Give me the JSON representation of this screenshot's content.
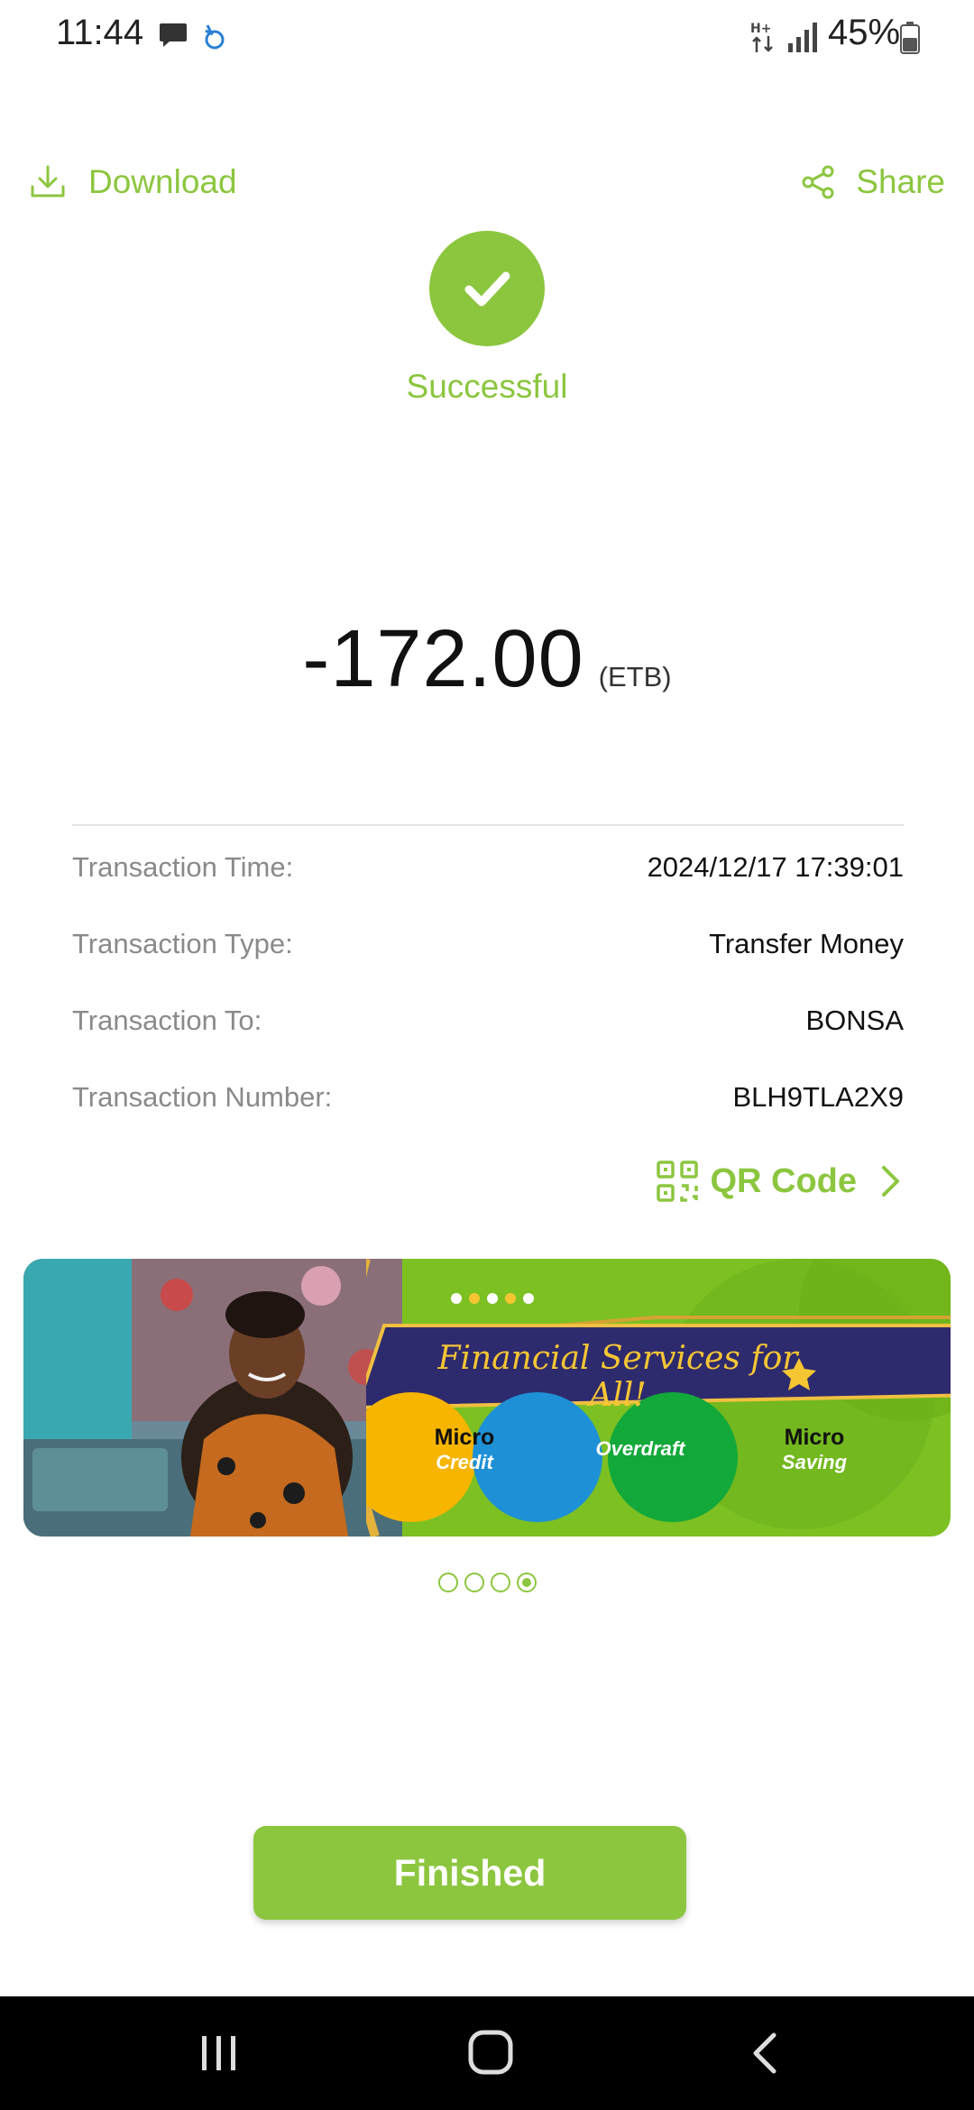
{
  "status_bar": {
    "time": "11:44",
    "battery": "45%",
    "icons": [
      "message-icon",
      "app-notification-icon",
      "mobile-data-icon",
      "signal-icon",
      "battery-icon"
    ]
  },
  "actions": {
    "download_label": "Download",
    "share_label": "Share"
  },
  "result": {
    "status": "Successful",
    "amount": "-172.00",
    "currency": "(ETB)"
  },
  "details": [
    {
      "label": "Transaction Time:",
      "value": "2024/12/17 17:39:01"
    },
    {
      "label": "Transaction Type:",
      "value": "Transfer Money"
    },
    {
      "label": "Transaction To:",
      "value": "BONSA"
    },
    {
      "label": "Transaction Number:",
      "value": "BLH9TLA2X9"
    }
  ],
  "qr": {
    "label": "QR Code"
  },
  "banner": {
    "title": "Financial Services for All!",
    "pills": [
      {
        "top": "Micro",
        "bottom": "Credit",
        "color": "#f7b500"
      },
      {
        "top": "",
        "bottom": "Overdraft",
        "color": "#1e90d6"
      },
      {
        "top": "Micro",
        "bottom": "Saving",
        "color": "#12a83a"
      }
    ],
    "page_count": 4,
    "active_page": 4
  },
  "footer": {
    "finished_label": "Finished"
  },
  "colors": {
    "accent": "#8cc63f",
    "banner_green": "#7cc022",
    "banner_title_bg": "#2e2a6e",
    "banner_title_text": "#f6c632"
  }
}
